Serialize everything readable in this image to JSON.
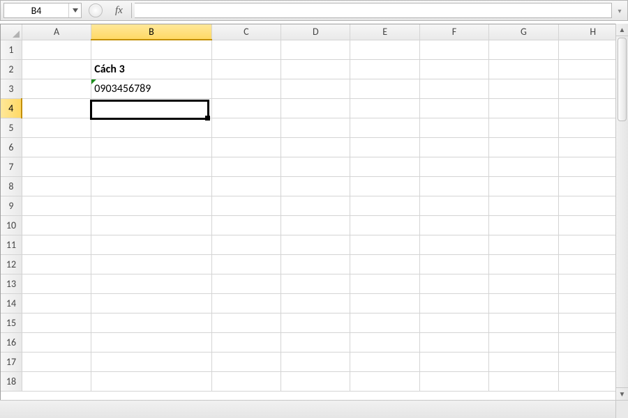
{
  "formula_bar": {
    "cell_ref": "B4",
    "fx_label": "fx",
    "formula_value": ""
  },
  "active_cell": {
    "col": "B",
    "row": 4
  },
  "columns": [
    "A",
    "B",
    "C",
    "D",
    "E",
    "F",
    "G",
    "H"
  ],
  "column_widths": {
    "A": 98,
    "B": 170,
    "default": 98
  },
  "rows_visible": 18,
  "cells": {
    "B2": {
      "value": "Cách 3",
      "bold": true
    },
    "B3": {
      "value": "0903456789",
      "text_indicator": true
    }
  }
}
